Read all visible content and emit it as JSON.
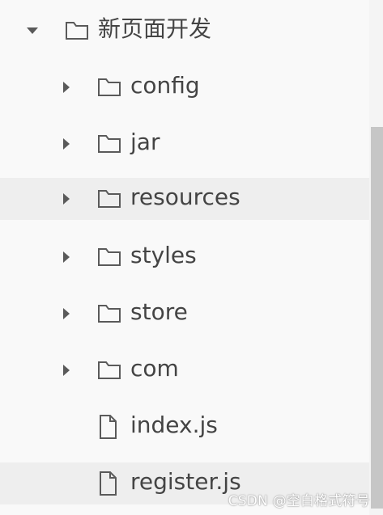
{
  "tree": {
    "root": {
      "label": "新页面开发",
      "icon": "folder-outline-icon",
      "expanded": true
    },
    "children": [
      {
        "label": "config",
        "icon": "folder-outline-icon",
        "expanded": false
      },
      {
        "label": "jar",
        "icon": "folder-outline-icon",
        "expanded": false
      },
      {
        "label": "resources",
        "icon": "folder-outline-icon",
        "expanded": false
      },
      {
        "label": "styles",
        "icon": "folder-outline-icon",
        "expanded": false
      },
      {
        "label": "store",
        "icon": "folder-outline-icon",
        "expanded": false
      },
      {
        "label": "com",
        "icon": "folder-outline-icon",
        "expanded": false
      },
      {
        "label": "index.js",
        "icon": "file-outline-icon"
      },
      {
        "label": "register.js",
        "icon": "file-outline-icon"
      }
    ]
  },
  "watermark": {
    "text": "CSDN @空白格式符号"
  },
  "colors": {
    "background": "#f9f9f9",
    "highlight_row": "#eeeeee",
    "text": "#444444",
    "scrollbar_track": "#f4f4f4",
    "scrollbar_thumb": "#c6c6c6"
  }
}
